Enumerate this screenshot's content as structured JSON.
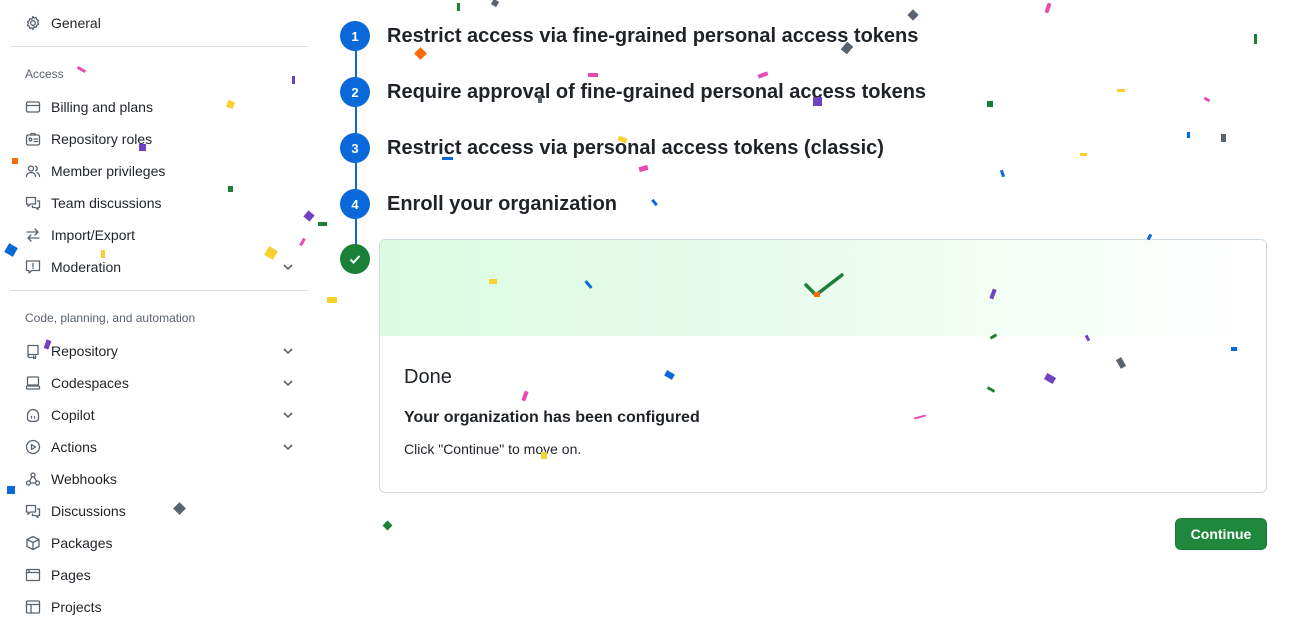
{
  "sidebar": {
    "general_label": "General",
    "access_section": "Access",
    "access_items": [
      {
        "label": "Billing and plans"
      },
      {
        "label": "Repository roles"
      },
      {
        "label": "Member privileges"
      },
      {
        "label": "Team discussions"
      },
      {
        "label": "Import/Export"
      },
      {
        "label": "Moderation"
      }
    ],
    "code_section": "Code, planning, and automation",
    "code_items": [
      {
        "label": "Repository"
      },
      {
        "label": "Codespaces"
      },
      {
        "label": "Copilot"
      },
      {
        "label": "Actions"
      },
      {
        "label": "Webhooks"
      },
      {
        "label": "Discussions"
      },
      {
        "label": "Packages"
      },
      {
        "label": "Pages"
      },
      {
        "label": "Projects"
      }
    ]
  },
  "steps": [
    {
      "number": "1",
      "title": "Restrict access via fine-grained personal access tokens"
    },
    {
      "number": "2",
      "title": "Require approval of fine-grained personal access tokens"
    },
    {
      "number": "3",
      "title": "Restrict access via personal access tokens (classic)"
    },
    {
      "number": "4",
      "title": "Enroll your organization"
    }
  ],
  "card": {
    "title": "Done",
    "subtitle": "Your organization has been configured",
    "text": "Click \"Continue\" to move on."
  },
  "continue_label": "Continue",
  "colors": {
    "accent_blue": "#0969da",
    "success_green": "#1a7f37",
    "button_green": "#1f883d"
  }
}
